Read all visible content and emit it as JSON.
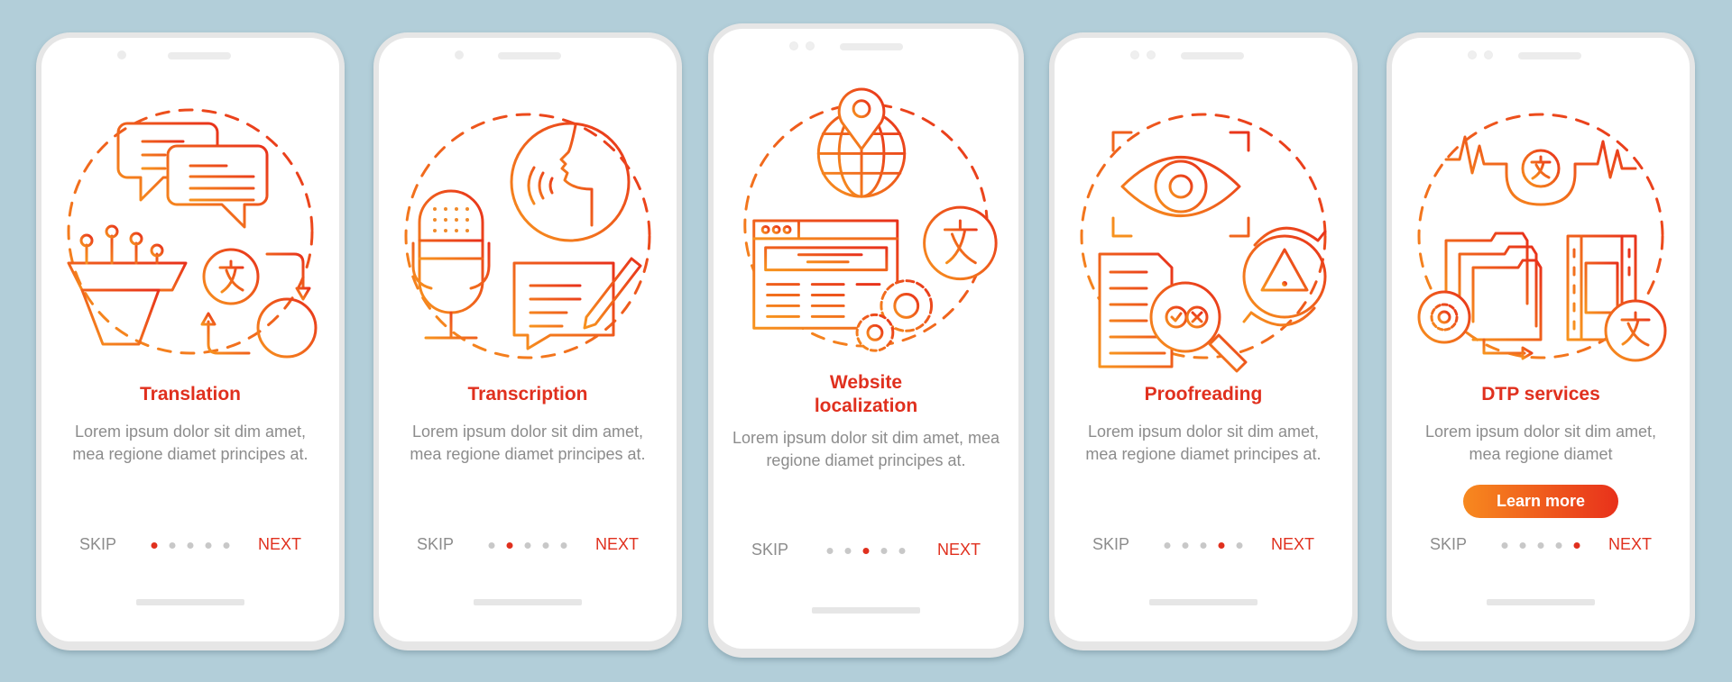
{
  "colors": {
    "accent": "#e0301e",
    "gradient_start": "#f7931e",
    "gradient_end": "#e8311b",
    "background": "#b2ced9",
    "body_text": "#8c8c8c"
  },
  "screens": [
    {
      "title": "Translation",
      "title_line2": "",
      "description": "Lorem ipsum dolor sit dim amet, mea regione diamet principes at.",
      "skip": "SKIP",
      "next": "NEXT",
      "active_step": 1,
      "total_steps": 5,
      "illustration": [
        "chat-bubbles-icon",
        "funnel-icon",
        "translate-icon",
        "arrow-cycle-icon"
      ]
    },
    {
      "title": "Transcription",
      "title_line2": "",
      "description": "Lorem ipsum dolor sit dim amet, mea regione diamet principes at.",
      "skip": "SKIP",
      "next": "NEXT",
      "active_step": 2,
      "total_steps": 5,
      "illustration": [
        "microphone-icon",
        "speaking-head-icon",
        "note-pencil-icon"
      ]
    },
    {
      "title": "Website",
      "title_line2": "localization",
      "description": "Lorem ipsum dolor sit dim amet, mea regione diamet principes at.",
      "skip": "SKIP",
      "next": "NEXT",
      "active_step": 3,
      "total_steps": 5,
      "illustration": [
        "globe-pin-icon",
        "browser-window-icon",
        "gears-icon",
        "translate-icon"
      ]
    },
    {
      "title": "Proofreading",
      "title_line2": "",
      "description": "Lorem ipsum dolor sit dim amet, mea regione diamet principes at.",
      "skip": "SKIP",
      "next": "NEXT",
      "active_step": 4,
      "total_steps": 5,
      "illustration": [
        "eye-scan-icon",
        "document-magnifier-icon",
        "warning-refresh-icon"
      ]
    },
    {
      "title": "DTP services",
      "title_line2": "",
      "description": "Lorem ipsum dolor sit dim amet, mea regione diamet",
      "skip": "SKIP",
      "next": "NEXT",
      "active_step": 5,
      "total_steps": 5,
      "button": "Learn more",
      "illustration": [
        "waveform-translate-icon",
        "folders-gear-icon",
        "film-strip-icon",
        "translate-icon"
      ]
    }
  ]
}
